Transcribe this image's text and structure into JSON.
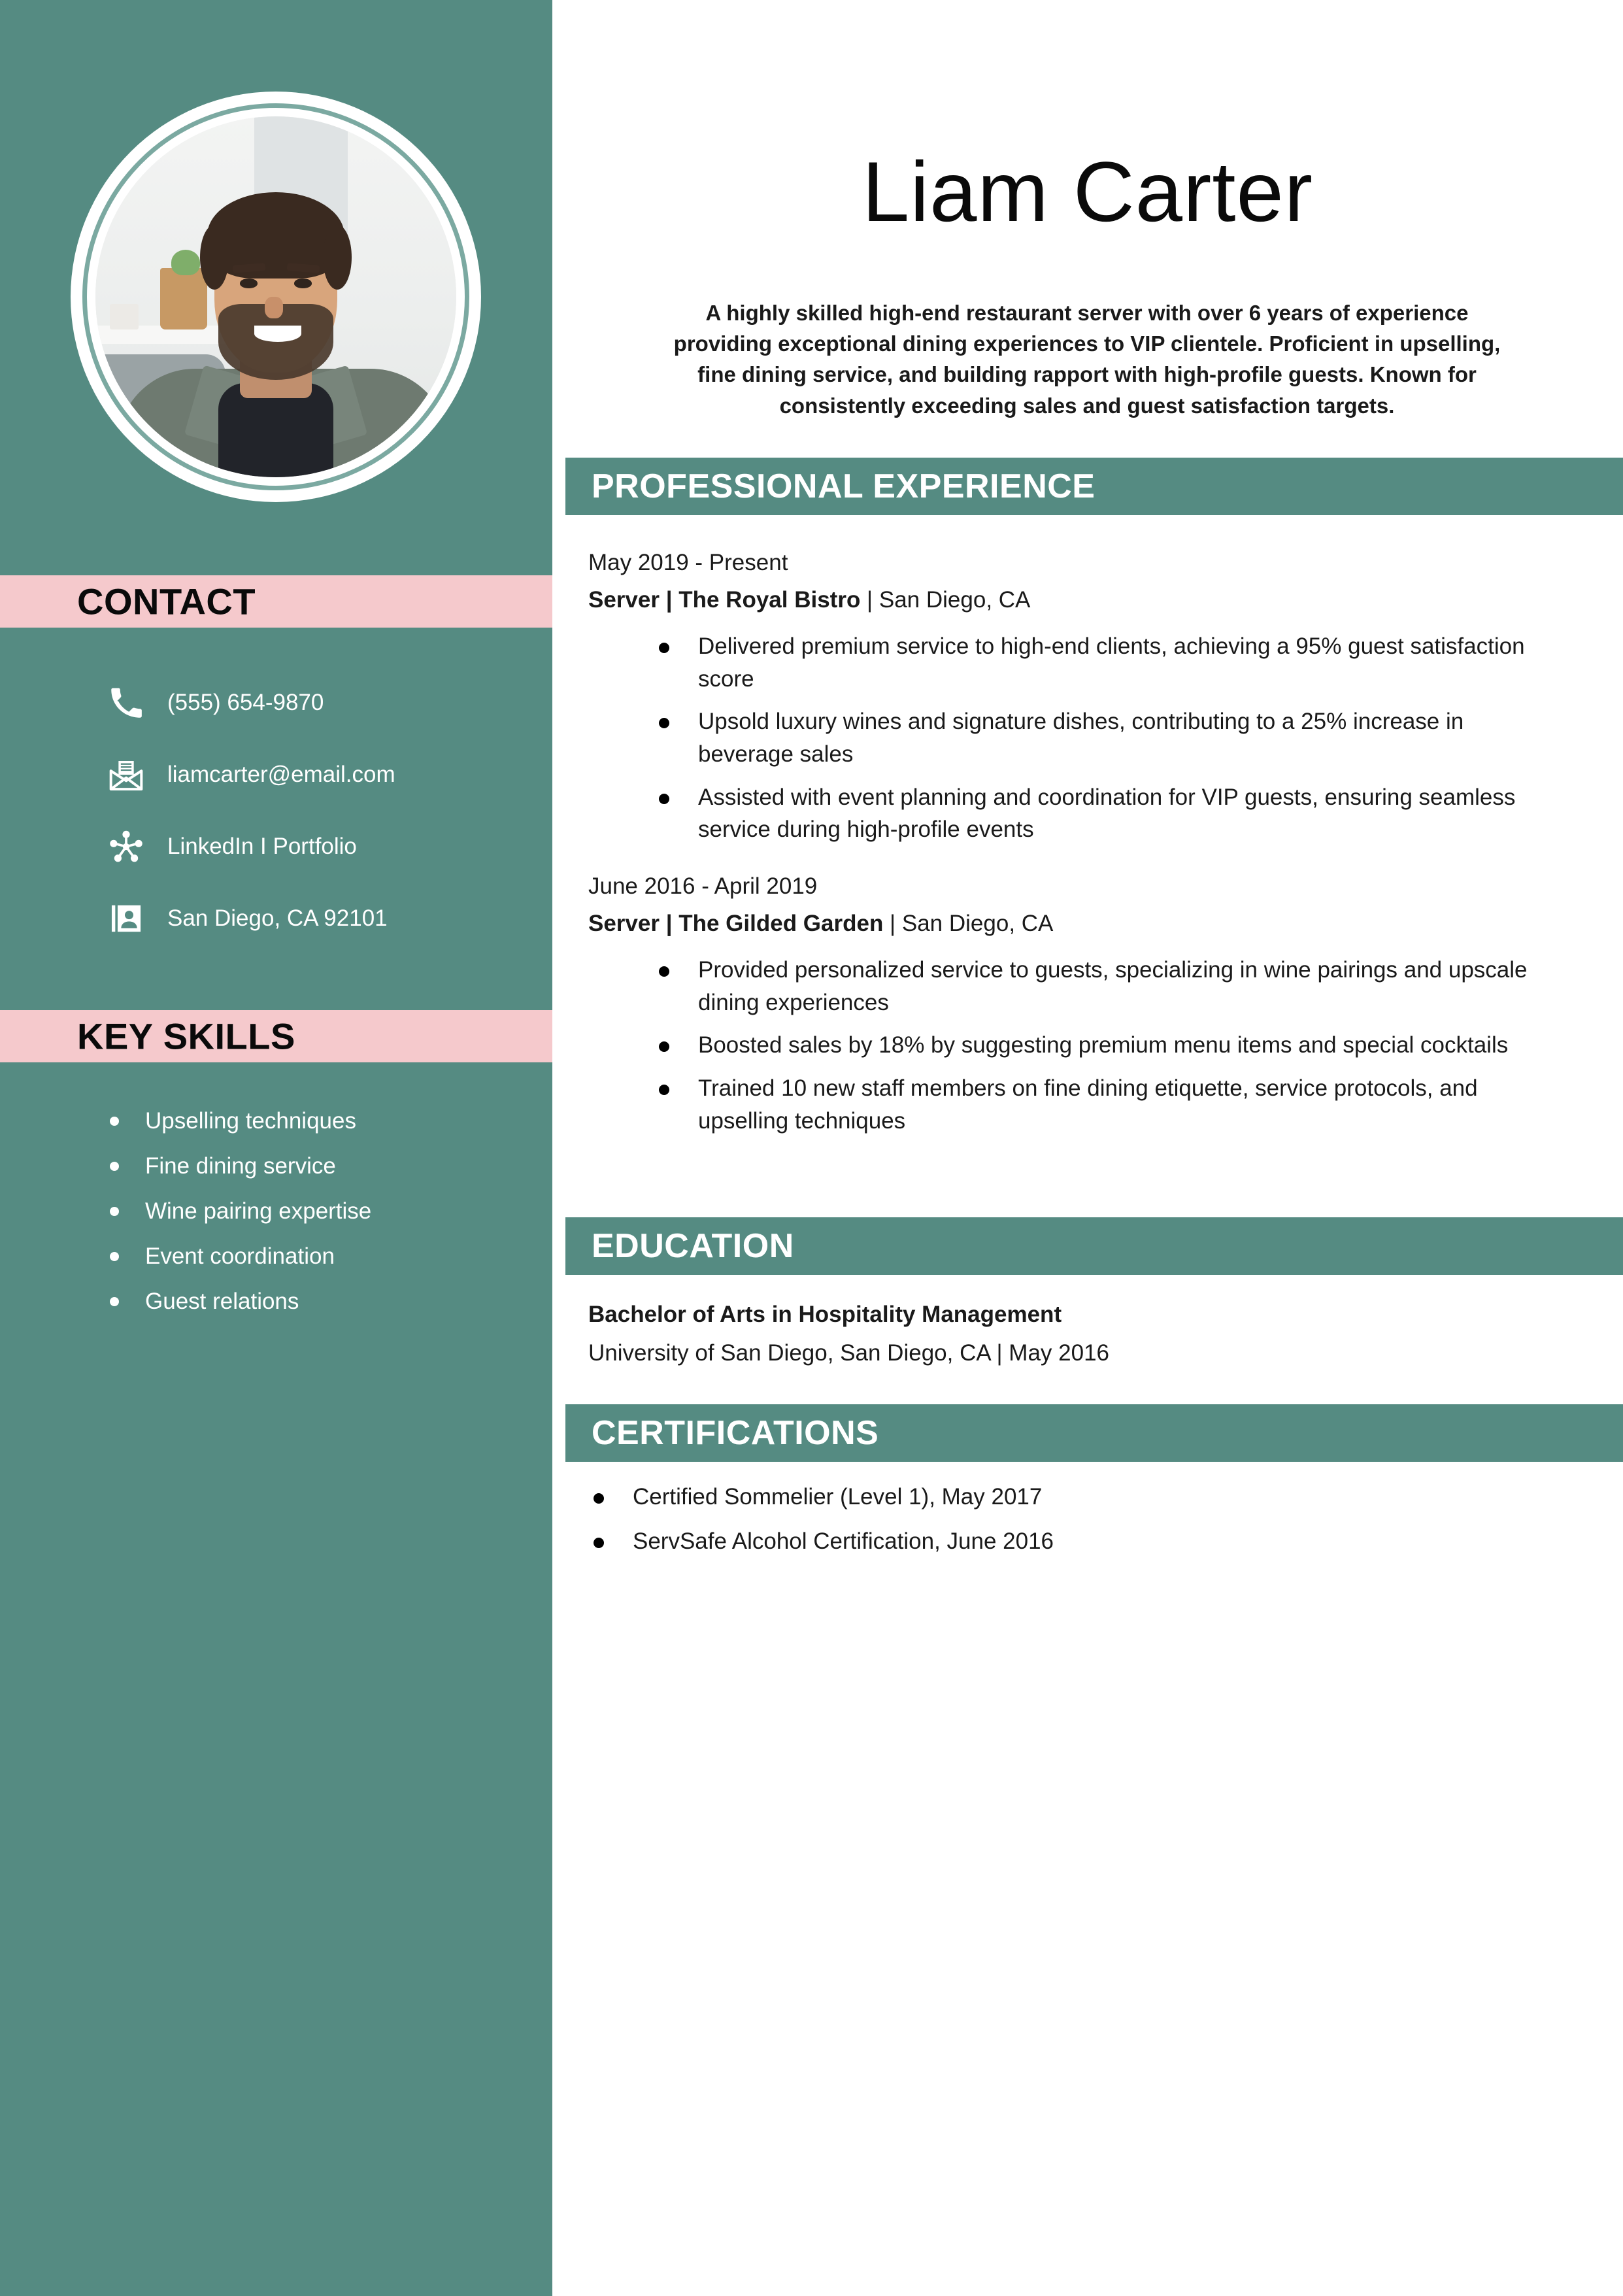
{
  "theme": {
    "sidebar_bg": "#558B82",
    "accent_pink": "#F5C9CC",
    "section_bar": "#558B82",
    "page_bg": "#FFFFFF",
    "text_dark": "#1A1A1A",
    "text_light": "#FFFFFF"
  },
  "header": {
    "name": "Liam Carter",
    "summary": "A highly skilled high-end restaurant server with over 6 years of experience providing exceptional dining experiences to VIP clientele. Proficient in upselling, fine dining service, and building rapport with high-profile guests. Known for consistently exceeding sales and guest satisfaction targets."
  },
  "sidebar": {
    "photo": {
      "alt": "portrait-photo"
    },
    "contact": {
      "heading": "CONTACT",
      "items": [
        {
          "icon": "phone-icon",
          "value": "(555) 654-9870"
        },
        {
          "icon": "envelope-icon",
          "value": "liamcarter@email.com"
        },
        {
          "icon": "network-share-icon",
          "value": "LinkedIn I Portfolio"
        },
        {
          "icon": "id-card-icon",
          "value": "San Diego, CA 92101"
        }
      ]
    },
    "skills": {
      "heading": "KEY SKILLS",
      "items": [
        "Upselling techniques",
        "Fine dining service",
        "Wine pairing expertise",
        "Event coordination",
        "Guest relations"
      ]
    }
  },
  "main": {
    "experience": {
      "heading": "PROFESSIONAL EXPERIENCE",
      "jobs": [
        {
          "dates": "May 2019 - Present",
          "role_company": "Server | The Royal Bistro",
          "location": " | San Diego, CA",
          "bullets": [
            "Delivered premium service to high-end clients, achieving a 95% guest satisfaction score",
            "Upsold luxury wines and signature dishes, contributing to a 25% increase in beverage sales",
            "Assisted with event planning and coordination for VIP guests, ensuring seamless service during high-profile events"
          ]
        },
        {
          "dates": "June 2016 - April 2019",
          "role_company": "Server | The Gilded Garden",
          "location": " | San Diego, CA",
          "bullets": [
            "Provided personalized service to guests, specializing in wine pairings and upscale dining experiences",
            "Boosted sales by 18% by suggesting premium menu items and special cocktails",
            "Trained 10 new staff members on fine dining etiquette, service protocols, and upselling techniques"
          ]
        }
      ]
    },
    "education": {
      "heading": "EDUCATION",
      "degree": "Bachelor of Arts in Hospitality Management",
      "school": "University of San Diego, San Diego, CA | May 2016"
    },
    "certifications": {
      "heading": "CERTIFICATIONS",
      "items": [
        "Certified Sommelier (Level 1), May 2017",
        "ServSafe Alcohol Certification, June 2016"
      ]
    }
  }
}
